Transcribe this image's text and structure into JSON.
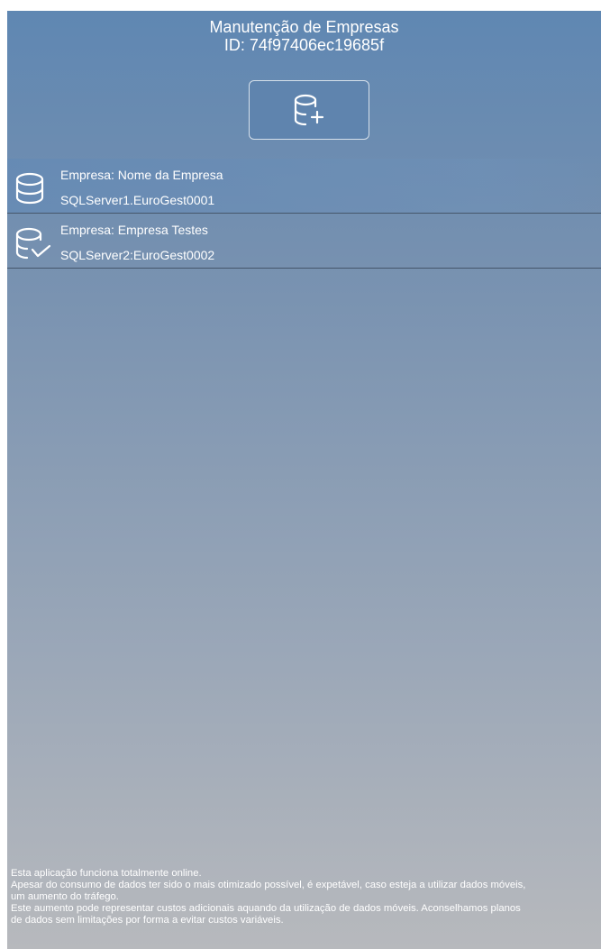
{
  "header": {
    "title": "Manutenção de Empresas",
    "id_line": "ID: 74f97406ec19685f"
  },
  "actions": {
    "add_company_icon": "database-add-icon"
  },
  "companies": [
    {
      "name": "Empresa: Nome da Empresa",
      "server": "SQLServer1.EuroGest0001",
      "icon": "database-icon",
      "selected": false
    },
    {
      "name": "Empresa: Empresa Testes",
      "server": "SQLServer2:EuroGest0002",
      "icon": "database-check-icon",
      "selected": true
    }
  ],
  "footer": {
    "lines": [
      "Esta aplicação funciona totalmente online.",
      "Apesar do consumo de dados ter sido o mais otimizado possível, é expetável, caso esteja a utilizar dados móveis,",
      "um aumento do tráfego.",
      "Este aumento pode representar custos adicionais aquando da utilização de dados móveis. Aconselhamos planos",
      "de dados sem limitações por forma a evitar custos variáveis."
    ]
  },
  "colors": {
    "background_top": "#5f87b2",
    "background_bottom": "#b7b9bd",
    "text": "#ffffff",
    "divider": "#45566a"
  }
}
